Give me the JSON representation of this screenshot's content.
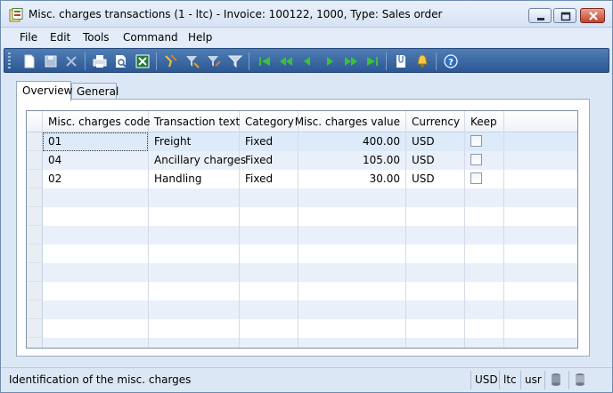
{
  "window": {
    "title": "Misc. charges transactions (1 - ltc) - Invoice: 100122, 1000, Type: Sales order"
  },
  "menu": [
    "File",
    "Edit",
    "Tools",
    "Command",
    "Help"
  ],
  "toolbar": {
    "buttons": [
      "new-icon",
      "save-icon",
      "delete-icon",
      "print-icon",
      "print-preview-icon",
      "export-excel-icon",
      "filter-by-field-icon",
      "filter-by-selection-icon",
      "advanced-filter-icon",
      "remove-filter-icon",
      "first-record-icon",
      "previous-page-icon",
      "previous-record-icon",
      "next-record-icon",
      "next-page-icon",
      "last-record-icon",
      "document-handling-icon",
      "alert-icon",
      "help-icon"
    ]
  },
  "tabs": [
    {
      "label": "Overview",
      "active": true
    },
    {
      "label": "General",
      "active": false
    }
  ],
  "grid": {
    "columns": [
      "Misc. charges code",
      "Transaction text",
      "Category",
      "Misc. charges value",
      "Currency",
      "Keep"
    ],
    "rows": [
      {
        "code": "01",
        "text": "Freight",
        "category": "Fixed",
        "value": "400.00",
        "currency": "USD",
        "keep": false
      },
      {
        "code": "04",
        "text": "Ancillary charges",
        "category": "Fixed",
        "value": "105.00",
        "currency": "USD",
        "keep": false
      },
      {
        "code": "02",
        "text": "Handling",
        "category": "Fixed",
        "value": "30.00",
        "currency": "USD",
        "keep": false
      }
    ]
  },
  "status": {
    "help_text": "Identification of the misc. charges",
    "currency": "USD",
    "company": "ltc",
    "layer": "usr"
  },
  "colors": {
    "toolbar_bg": "#3d6aa5",
    "selected_row": "#dceaf9",
    "alt_row": "#eaf0fa"
  }
}
